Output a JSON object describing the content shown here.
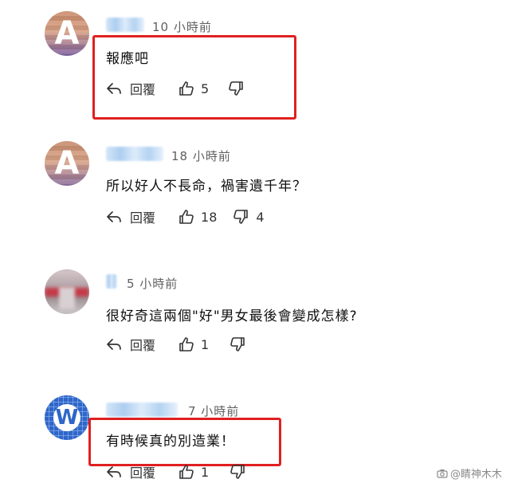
{
  "comments": [
    {
      "time": "10 小時前",
      "text": "報應吧",
      "reply_label": "回覆",
      "like_count": "5",
      "dislike_count": "",
      "avatar_letter": "A"
    },
    {
      "time": "18 小時前",
      "text": "所以好人不長命，禍害遺千年？",
      "reply_label": "回覆",
      "like_count": "18",
      "dislike_count": "4",
      "avatar_letter": "A"
    },
    {
      "time": "5 小時前",
      "text": "很好奇這兩個\"好\"男女最後會變成怎樣?",
      "reply_label": "回覆",
      "like_count": "1",
      "dislike_count": "",
      "avatar_letter": ""
    },
    {
      "time": "7 小時前",
      "text": "有時候真的別造業！",
      "reply_label": "回覆",
      "like_count": "1",
      "dislike_count": "",
      "avatar_letter": "W"
    }
  ],
  "watermark": "@睛神木木",
  "icons": [
    "reply-icon",
    "thumbs-up-icon",
    "thumbs-down-icon",
    "camera-icon"
  ],
  "colors": {
    "highlight": "#e02020",
    "text": "#0f0f0f",
    "meta": "#606060"
  }
}
